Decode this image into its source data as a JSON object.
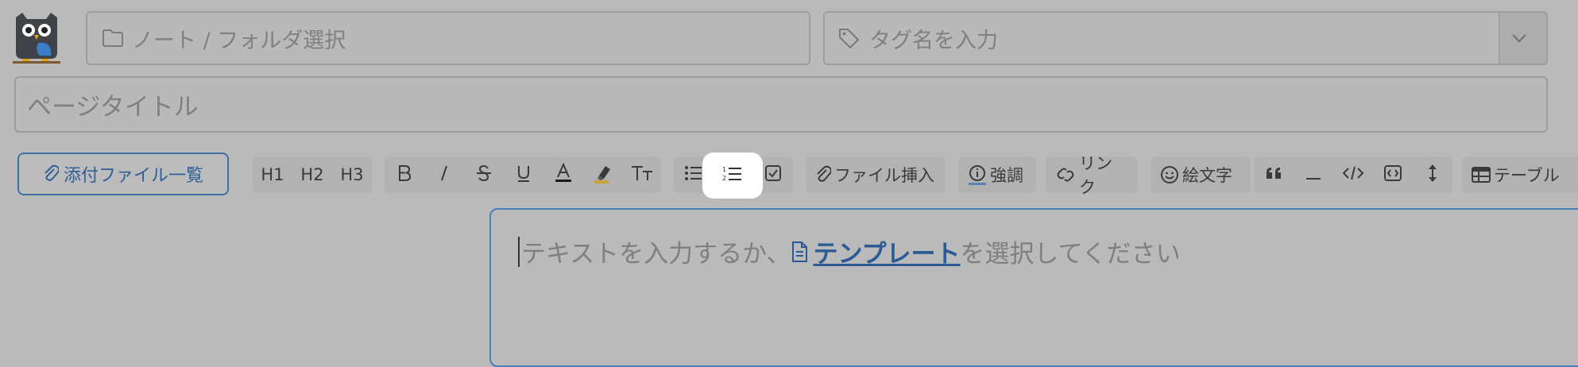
{
  "header": {
    "note_folder_placeholder": "ノート / フォルダ選択",
    "tag_placeholder": "タグ名を入力",
    "page_title_placeholder": "ページタイトル"
  },
  "toolbar": {
    "attach_list_label": "添付ファイル一覧",
    "h1": "H1",
    "h2": "H2",
    "h3": "H3",
    "file_insert_label": "ファイル挿入",
    "emphasis_label": "強調",
    "link_label": "リンク",
    "emoji_label": "絵文字",
    "table_label": "テーブル",
    "active_item": "ordered-list"
  },
  "editor": {
    "prompt_before": "テキストを入力するか、",
    "template_link": "テンプレート",
    "prompt_after": "を選択してください"
  },
  "colors": {
    "accent": "#2f5f98",
    "background": "#bababa",
    "highlight": "#ffffff"
  }
}
